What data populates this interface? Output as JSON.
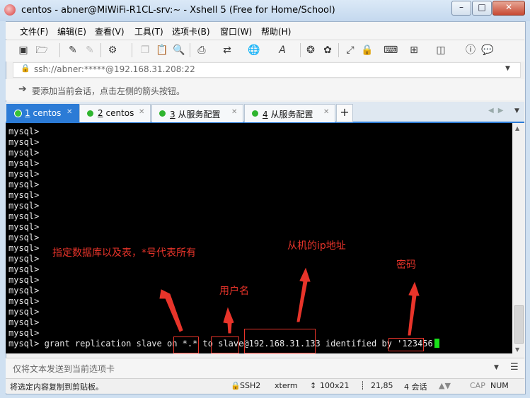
{
  "window": {
    "title": "centos - abner@MiWiFi-R1CL-srv:~ - Xshell 5 (Free for Home/School)"
  },
  "menu": [
    "文件(F)",
    "编辑(E)",
    "查看(V)",
    "工具(T)",
    "选项卡(B)",
    "窗口(W)",
    "帮助(H)"
  ],
  "address": {
    "value": "ssh://abner:*****@192.168.31.208:22"
  },
  "hint": {
    "text": "要添加当前会话，点击左侧的箭头按钮。"
  },
  "tabs": [
    {
      "num": "1",
      "label": "centos",
      "active": true
    },
    {
      "num": "2",
      "label": "centos",
      "active": false
    },
    {
      "num": "3",
      "label": "从服务配置",
      "active": false
    },
    {
      "num": "4",
      "label": "从服务配置",
      "active": false
    }
  ],
  "terminal": {
    "prompt": "mysql>",
    "empty_prompt_lines": 20,
    "command": {
      "prefix": "mysql> grant replication slave on ",
      "db": "*.*",
      "mid": " to ",
      "user": "slave",
      "at": "@",
      "host": "192.168.31.133",
      "after": " identified by '",
      "password": "123456"
    }
  },
  "annotations": {
    "db_note": "指定数据库以及表，*号代表所有",
    "user_note": "用户名",
    "host_note": "从机的ip地址",
    "password_note": "密码"
  },
  "sendbar": {
    "placeholder": "仅将文本发送到当前选项卡"
  },
  "status": {
    "left": "将选定内容复制到剪贴板。",
    "protocol": "SSH2",
    "term": "xterm",
    "size": "100x21",
    "position": "21,85",
    "sessions": "4 会话",
    "cap": "CAP",
    "num": "NUM"
  },
  "colors": {
    "accent": "#2b7bd6",
    "annotation": "#e8342a",
    "cursor": "#19e019"
  }
}
